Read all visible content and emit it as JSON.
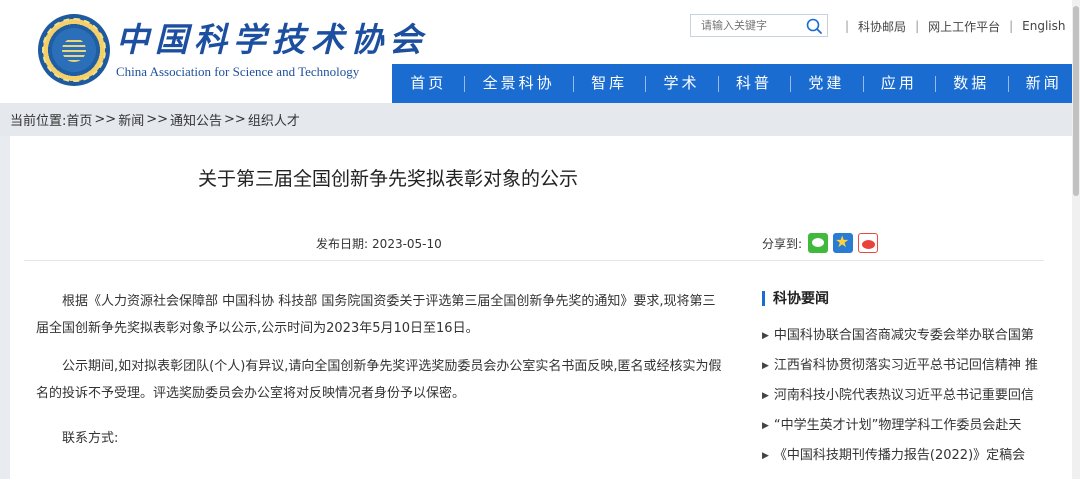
{
  "header": {
    "logo_cn": "中国科学技术协会",
    "logo_en": "China Association for Science and Technology",
    "search": {
      "placeholder": "请输入关键字",
      "value": ""
    },
    "top_links": [
      "科协邮局",
      "网上工作平台",
      "English"
    ],
    "nav": [
      "首页",
      "全景科协",
      "智库",
      "学术",
      "科普",
      "党建",
      "应用",
      "数据",
      "新闻"
    ]
  },
  "breadcrumb": {
    "label": "当前位置:",
    "items": [
      "首页",
      "新闻",
      "通知公告",
      "组织人才"
    ],
    "separator": ">>"
  },
  "article": {
    "title": "关于第三届全国创新争先奖拟表彰对象的公示",
    "date_label": "发布日期:",
    "date": "2023-05-10",
    "share_label": "分享到:",
    "paragraphs": [
      "根据《人力资源社会保障部 中国科协 科技部 国务院国资委关于评选第三届全国创新争先奖的通知》要求,现将第三届全国创新争先奖拟表彰对象予以公示,公示时间为2023年5月10日至16日。",
      "公示期间,如对拟表彰团队(个人)有异议,请向全国创新争先奖评选奖励委员会办公室实名书面反映,匿名或经核实为假名的投诉不予受理。评选奖励委员会办公室将对反映情况者身份予以保密。"
    ],
    "contact_label": "联系方式:"
  },
  "sidebar": {
    "title": "科协要闻",
    "items": [
      "中国科协联合国咨商减灾专委会举办联合国第",
      "江西省科协贯彻落实习近平总书记回信精神 推",
      "河南科技小院代表热议习近平总书记重要回信",
      "“中学生英才计划”物理学科工作委员会赴天",
      "《中国科技期刊传播力报告(2022)》定稿会"
    ]
  },
  "colors": {
    "nav_blue": "#1a6cd1",
    "logo_blue": "#1c4fa0",
    "page_bg": "#e8ecf1"
  },
  "icons": {
    "search": "search-icon",
    "share": [
      "wechat-icon",
      "qzone-icon",
      "weibo-icon"
    ],
    "list_marker": "triangle-right-icon"
  }
}
